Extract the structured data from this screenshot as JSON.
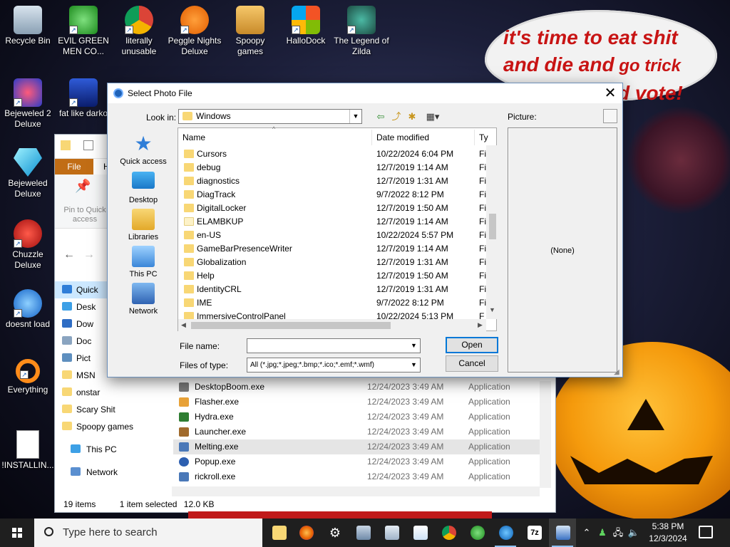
{
  "desktop": {
    "wallpaper_text_line1": "it's time to eat shit",
    "wallpaper_text_line2a": "and die and",
    "wallpaper_text_line2b": " go trick",
    "wallpaper_text_line3": "d vote!",
    "icons": [
      {
        "label": "Recycle Bin",
        "icon": "recycle-bin-icon"
      },
      {
        "label": "EVIL GREEN MEN CO...",
        "icon": "green-men-icon"
      },
      {
        "label": "literally unusable",
        "icon": "chrome-icon"
      },
      {
        "label": "Peggle Nights Deluxe",
        "icon": "peggle-icon"
      },
      {
        "label": "Spoopy games",
        "icon": "folder-icon"
      },
      {
        "label": "HalloDock",
        "icon": "windows-logo-icon"
      },
      {
        "label": "The Legend of Zilda",
        "icon": "zilda-icon"
      },
      {
        "label": "Bejeweled 2 Deluxe",
        "icon": "bejeweled2-icon"
      },
      {
        "label": "fat like darko",
        "icon": "mpl-icon"
      },
      {
        "label": "Bejeweled Deluxe",
        "icon": "diamond-icon"
      },
      {
        "label": "Chuzzle Deluxe",
        "icon": "chuzzle-icon"
      },
      {
        "label": "doesnt load",
        "icon": "thunderbird-icon"
      },
      {
        "label": "Everything",
        "icon": "everything-search-icon"
      },
      {
        "label": "!INSTALLIN...",
        "icon": "text-document-icon"
      }
    ]
  },
  "explorer": {
    "file_tab": "File",
    "ribbon_tab_h": "H",
    "pin_label": "Pin to Quick access",
    "nav": [
      {
        "label": "Quick",
        "selected": true
      },
      {
        "label": "Desk"
      },
      {
        "label": "Dow"
      },
      {
        "label": "Doc"
      },
      {
        "label": "Pict"
      },
      {
        "label": "MSN"
      },
      {
        "label": "onstar"
      },
      {
        "label": "Scary Shit"
      },
      {
        "label": "Spoopy games"
      },
      {
        "label": "This PC"
      },
      {
        "label": "Network"
      }
    ],
    "files": [
      {
        "name": "DesktopBoom.exe",
        "date": "12/24/2023 3:49 AM",
        "type": "Application"
      },
      {
        "name": "Flasher.exe",
        "date": "12/24/2023 3:49 AM",
        "type": "Application"
      },
      {
        "name": "Hydra.exe",
        "date": "12/24/2023 3:49 AM",
        "type": "Application"
      },
      {
        "name": "Launcher.exe",
        "date": "12/24/2023 3:49 AM",
        "type": "Application"
      },
      {
        "name": "Melting.exe",
        "date": "12/24/2023 3:49 AM",
        "type": "Application",
        "selected": true
      },
      {
        "name": "Popup.exe",
        "date": "12/24/2023 3:49 AM",
        "type": "Application"
      },
      {
        "name": "rickroll.exe",
        "date": "12/24/2023 3:49 AM",
        "type": "Application"
      }
    ],
    "status_items": "19 items",
    "status_selected": "1 item selected",
    "status_size": "12.0 KB"
  },
  "dialog": {
    "title": "Select Photo File",
    "look_in_label": "Look in:",
    "look_in_value": "Windows",
    "picture_label": "Picture:",
    "picture_value": "(None)",
    "places": [
      {
        "label": "Quick access",
        "icon": "star-icon"
      },
      {
        "label": "Desktop",
        "icon": "desktop-icon"
      },
      {
        "label": "Libraries",
        "icon": "libraries-icon"
      },
      {
        "label": "This PC",
        "icon": "computer-icon"
      },
      {
        "label": "Network",
        "icon": "network-icon"
      }
    ],
    "columns": {
      "name": "Name",
      "date": "Date modified",
      "type": "Ty"
    },
    "files": [
      {
        "name": "Cursors",
        "date": "10/22/2024 6:04 PM",
        "type": "Fil"
      },
      {
        "name": "debug",
        "date": "12/7/2019 1:14 AM",
        "type": "Fil"
      },
      {
        "name": "diagnostics",
        "date": "12/7/2019 1:31 AM",
        "type": "Fil"
      },
      {
        "name": "DiagTrack",
        "date": "9/7/2022 8:12 PM",
        "type": "Fil"
      },
      {
        "name": "DigitalLocker",
        "date": "12/7/2019 1:50 AM",
        "type": "Fil"
      },
      {
        "name": "ELAMBKUP",
        "date": "12/7/2019 1:14 AM",
        "type": "Fil"
      },
      {
        "name": "en-US",
        "date": "10/22/2024 5:57 PM",
        "type": "Fil"
      },
      {
        "name": "GameBarPresenceWriter",
        "date": "12/7/2019 1:14 AM",
        "type": "Fil"
      },
      {
        "name": "Globalization",
        "date": "12/7/2019 1:31 AM",
        "type": "Fil"
      },
      {
        "name": "Help",
        "date": "12/7/2019 1:50 AM",
        "type": "Fil"
      },
      {
        "name": "IdentityCRL",
        "date": "12/7/2019 1:31 AM",
        "type": "Fil"
      },
      {
        "name": "IME",
        "date": "9/7/2022 8:12 PM",
        "type": "Fil"
      },
      {
        "name": "ImmersiveControlPanel",
        "date": "10/22/2024 5:13 PM",
        "type": "Fil"
      }
    ],
    "file_name_label": "File name:",
    "file_name_value": "",
    "files_of_type_label": "Files of type:",
    "files_of_type_value": "All (*.jpg;*.jpeg;*.bmp;*.ico;*.emf;*.wmf)",
    "open_label": "Open",
    "cancel_label": "Cancel",
    "close_glyph": "✕"
  },
  "taskbar": {
    "search_placeholder": "Type here to search",
    "time": "5:38 PM",
    "date": "12/3/2024",
    "apps": [
      "file-explorer-icon",
      "firefox-icon",
      "settings-gear-icon",
      "scanner-icon",
      "windows-tool-icon",
      "notepad-icon",
      "chrome-icon",
      "green-men-icon",
      "edge-icon",
      "7zip-icon",
      "photo-app-icon"
    ]
  }
}
